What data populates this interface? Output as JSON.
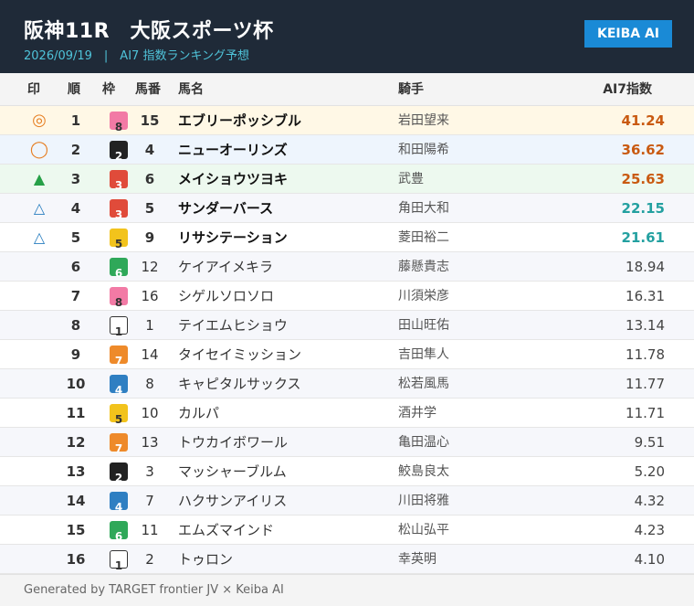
{
  "header": {
    "title": "阪神11R　大阪スポーツ杯",
    "subtitle": "2026/09/19　|　AI7 指数ランキング予想",
    "badge": "KEIBA AI"
  },
  "columns": {
    "mark": "印",
    "rank": "順",
    "waku": "枠",
    "umaban": "馬番",
    "horse": "馬名",
    "jockey": "騎手",
    "score": "AI7指数"
  },
  "waku_colors": {
    "1": {
      "bg": "#ffffff",
      "fg": "#333333",
      "border": "#333333"
    },
    "2": {
      "bg": "#222222",
      "fg": "#ffffff",
      "border": "#222222"
    },
    "3": {
      "bg": "#e04b3a",
      "fg": "#ffffff",
      "border": "#e04b3a"
    },
    "4": {
      "bg": "#2f7fc2",
      "fg": "#ffffff",
      "border": "#2f7fc2"
    },
    "5": {
      "bg": "#f2c31c",
      "fg": "#333333",
      "border": "#f2c31c"
    },
    "6": {
      "bg": "#2fa859",
      "fg": "#ffffff",
      "border": "#2fa859"
    },
    "7": {
      "bg": "#ee8a2a",
      "fg": "#ffffff",
      "border": "#ee8a2a"
    },
    "8": {
      "bg": "#f27aa5",
      "fg": "#333333",
      "border": "#f27aa5"
    }
  },
  "score_colors": {
    "high": "#c95a11",
    "mid": "#23a0a0"
  },
  "rows": [
    {
      "mark": "◎",
      "mark_type": "double",
      "rank": "1",
      "waku": "8",
      "umaban": "15",
      "horse": "エブリーポッシブル",
      "jockey": "岩田望来",
      "score": "41.24",
      "tone": "high"
    },
    {
      "mark": "◯",
      "mark_type": "circle",
      "rank": "2",
      "waku": "2",
      "umaban": "4",
      "horse": "ニューオーリンズ",
      "jockey": "和田陽希",
      "score": "36.62",
      "tone": "high"
    },
    {
      "mark": "▲",
      "mark_type": "tri",
      "rank": "3",
      "waku": "3",
      "umaban": "6",
      "horse": "メイショウツヨキ",
      "jockey": "武豊",
      "score": "25.63",
      "tone": "high"
    },
    {
      "mark": "△",
      "mark_type": "otri",
      "rank": "4",
      "waku": "3",
      "umaban": "5",
      "horse": "サンダーバース",
      "jockey": "角田大和",
      "score": "22.15",
      "tone": "mid"
    },
    {
      "mark": "△",
      "mark_type": "otri",
      "rank": "5",
      "waku": "5",
      "umaban": "9",
      "horse": "リサシテーション",
      "jockey": "菱田裕二",
      "score": "21.61",
      "tone": "mid"
    },
    {
      "mark": "",
      "mark_type": "",
      "rank": "6",
      "waku": "6",
      "umaban": "12",
      "horse": "ケイアイメキラ",
      "jockey": "藤懸貴志",
      "score": "18.94",
      "tone": ""
    },
    {
      "mark": "",
      "mark_type": "",
      "rank": "7",
      "waku": "8",
      "umaban": "16",
      "horse": "シゲルソロソロ",
      "jockey": "川須栄彦",
      "score": "16.31",
      "tone": ""
    },
    {
      "mark": "",
      "mark_type": "",
      "rank": "8",
      "waku": "1",
      "umaban": "1",
      "horse": "テイエムヒショウ",
      "jockey": "田山旺佑",
      "score": "13.14",
      "tone": ""
    },
    {
      "mark": "",
      "mark_type": "",
      "rank": "9",
      "waku": "7",
      "umaban": "14",
      "horse": "タイセイミッション",
      "jockey": "吉田隼人",
      "score": "11.78",
      "tone": ""
    },
    {
      "mark": "",
      "mark_type": "",
      "rank": "10",
      "waku": "4",
      "umaban": "8",
      "horse": "キャピタルサックス",
      "jockey": "松若風馬",
      "score": "11.77",
      "tone": ""
    },
    {
      "mark": "",
      "mark_type": "",
      "rank": "11",
      "waku": "5",
      "umaban": "10",
      "horse": "カルパ",
      "jockey": "酒井学",
      "score": "11.71",
      "tone": ""
    },
    {
      "mark": "",
      "mark_type": "",
      "rank": "12",
      "waku": "7",
      "umaban": "13",
      "horse": "トウカイボワール",
      "jockey": "亀田温心",
      "score": "9.51",
      "tone": ""
    },
    {
      "mark": "",
      "mark_type": "",
      "rank": "13",
      "waku": "2",
      "umaban": "3",
      "horse": "マッシャーブルム",
      "jockey": "鮫島良太",
      "score": "5.20",
      "tone": ""
    },
    {
      "mark": "",
      "mark_type": "",
      "rank": "14",
      "waku": "4",
      "umaban": "7",
      "horse": "ハクサンアイリス",
      "jockey": "川田将雅",
      "score": "4.32",
      "tone": ""
    },
    {
      "mark": "",
      "mark_type": "",
      "rank": "15",
      "waku": "6",
      "umaban": "11",
      "horse": "エムズマインド",
      "jockey": "松山弘平",
      "score": "4.23",
      "tone": ""
    },
    {
      "mark": "",
      "mark_type": "",
      "rank": "16",
      "waku": "1",
      "umaban": "2",
      "horse": "トゥロン",
      "jockey": "幸英明",
      "score": "4.10",
      "tone": ""
    }
  ],
  "footer": "Generated by TARGET frontier JV × Keiba AI"
}
